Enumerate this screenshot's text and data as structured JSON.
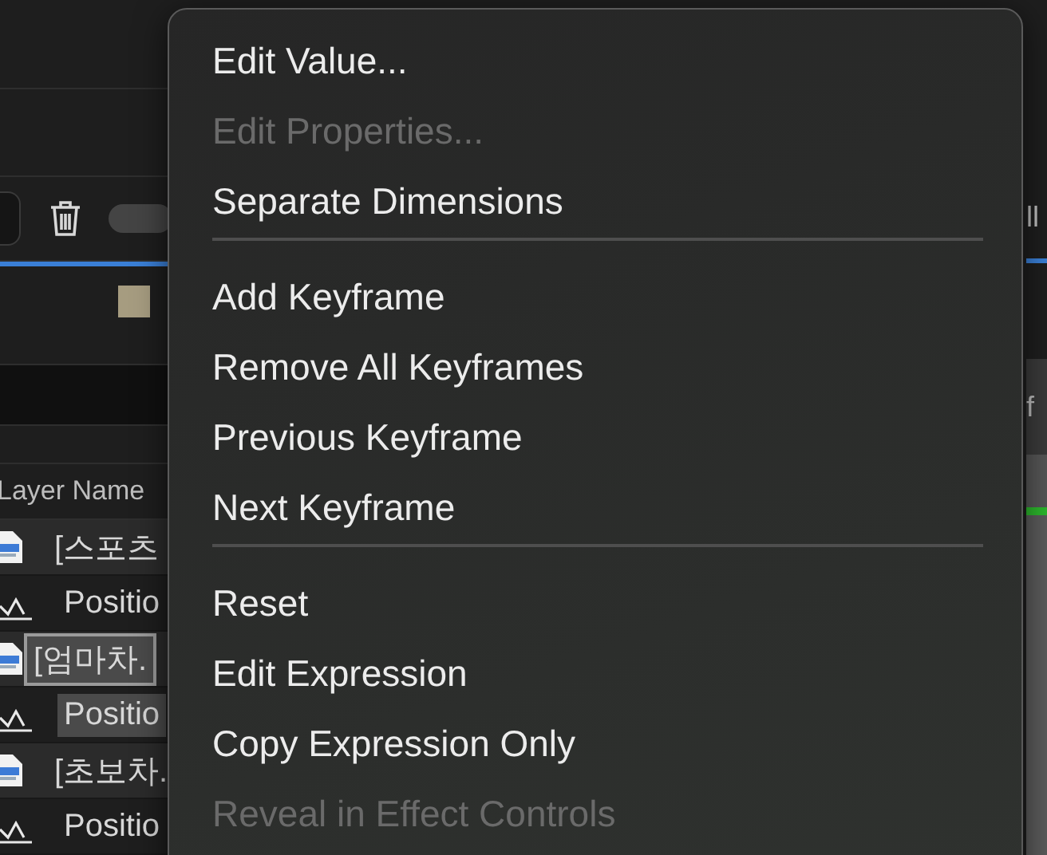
{
  "toolbar": {
    "fragment": "ll",
    "toggle": {
      "on": false
    }
  },
  "timeline_header": {
    "fragment": "f"
  },
  "layer_panel": {
    "column_header": "Layer Name",
    "rows": [
      {
        "kind": "layer",
        "label": "[스포츠",
        "selected": false
      },
      {
        "kind": "property",
        "label": "Positio",
        "selected": false
      },
      {
        "kind": "layer",
        "label": "[엄마차.",
        "selected": true
      },
      {
        "kind": "property",
        "label": "Positio",
        "selected": true
      },
      {
        "kind": "layer",
        "label": "[초보차.",
        "selected": false
      },
      {
        "kind": "property",
        "label": "Positio",
        "selected": false
      }
    ]
  },
  "context_menu": {
    "items": [
      {
        "kind": "item",
        "label": "Edit Value...",
        "disabled": false
      },
      {
        "kind": "item",
        "label": "Edit Properties...",
        "disabled": true
      },
      {
        "kind": "item",
        "label": "Separate Dimensions",
        "disabled": false
      },
      {
        "kind": "separator"
      },
      {
        "kind": "item",
        "label": "Add Keyframe",
        "disabled": false
      },
      {
        "kind": "item",
        "label": "Remove All Keyframes",
        "disabled": false
      },
      {
        "kind": "item",
        "label": "Previous Keyframe",
        "disabled": false
      },
      {
        "kind": "item",
        "label": "Next Keyframe",
        "disabled": false
      },
      {
        "kind": "separator"
      },
      {
        "kind": "item",
        "label": "Reset",
        "disabled": false
      },
      {
        "kind": "item",
        "label": "Edit Expression",
        "disabled": false
      },
      {
        "kind": "item",
        "label": "Copy Expression Only",
        "disabled": false
      },
      {
        "kind": "item",
        "label": "Reveal in Effect Controls",
        "disabled": true
      }
    ]
  }
}
